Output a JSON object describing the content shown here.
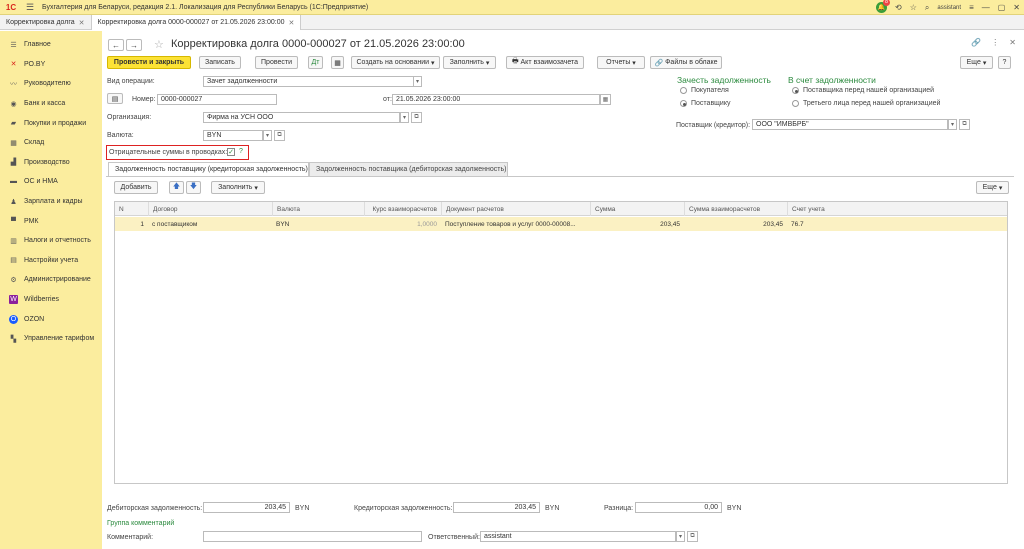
{
  "titlebar": {
    "logo": "1С",
    "title": "Бухгалтерия для Беларуси, редакция 2.1. Локализация для Республики Беларусь   (1С:Предприятие)",
    "notif_count": "8",
    "user": "assistant"
  },
  "tabs": [
    {
      "label": "Корректировка долга"
    },
    {
      "label": "Корректировка долга 0000-000027 от 21.05.2026 23:00:00"
    }
  ],
  "sidebar": {
    "items": [
      {
        "label": "Главное",
        "icon": "menu-icon"
      },
      {
        "label": "РО.BY",
        "icon": "link-icon"
      },
      {
        "label": "Руководителю",
        "icon": "chart-icon"
      },
      {
        "label": "Банк и касса",
        "icon": "bank-icon"
      },
      {
        "label": "Покупки и продажи",
        "icon": "cart-icon"
      },
      {
        "label": "Склад",
        "icon": "warehouse-icon"
      },
      {
        "label": "Производство",
        "icon": "factory-icon"
      },
      {
        "label": "ОС и НМА",
        "icon": "car-icon"
      },
      {
        "label": "Зарплата и кадры",
        "icon": "people-icon"
      },
      {
        "label": "РМК",
        "icon": "register-icon"
      },
      {
        "label": "Налоги и отчетность",
        "icon": "tax-icon"
      },
      {
        "label": "Настройки учета",
        "icon": "settings-icon"
      },
      {
        "label": "Администрирование",
        "icon": "gear-icon"
      },
      {
        "label": "Wildberries",
        "icon": "wildberries-icon"
      },
      {
        "label": "OZON",
        "icon": "ozon-icon"
      },
      {
        "label": "Управление тарифом",
        "icon": "grid-icon"
      }
    ]
  },
  "doc": {
    "title": "Корректировка долга 0000-000027 от 21.05.2026 23:00:00"
  },
  "toolbar": {
    "post_close": "Провести и закрыть",
    "save": "Записать",
    "post": "Провести",
    "create_based": "Создать на основании",
    "fill": "Заполнить",
    "act": "Акт взаимозачета",
    "reports": "Отчеты",
    "files": "Файлы в облаке",
    "more": "Еще"
  },
  "form": {
    "op_label": "Вид операции:",
    "op_value": "Зачет задолженности",
    "number_label": "Номер:",
    "number_value": "0000-000027",
    "date_label": "от:",
    "date_value": "21.05.2026 23:00:00",
    "org_label": "Организация:",
    "org_value": "Фирма на УСН ООО",
    "currency_label": "Валюта:",
    "currency_value": "BYN",
    "negative_label": "Отрицательные суммы в проводках:",
    "negative_help": "?",
    "offset_head": "Зачесть задолженность",
    "offset_buyer": "Покупателя",
    "offset_supplier": "Поставщику",
    "account_head": "В счет задолженности",
    "account_supplier": "Поставщика перед нашей организацией",
    "account_third": "Третьего лица перед нашей организацией",
    "supplier_label": "Поставщик (кредитор):",
    "supplier_value": "ООО \"ИМВБРБ\""
  },
  "subtabs": [
    {
      "label": "Задолженность поставщику (кредиторская задолженность)"
    },
    {
      "label": "Задолженность поставщика (дебиторская задолженность)"
    }
  ],
  "table_toolbar": {
    "add": "Добавить",
    "fill": "Заполнить",
    "more": "Еще"
  },
  "table": {
    "columns": [
      "N",
      "Договор",
      "Валюта",
      "Курс взаиморасчетов",
      "Документ расчетов",
      "Сумма",
      "Сумма взаиморасчетов",
      "Счет учета"
    ],
    "rows": [
      [
        "1",
        "с поставщиком",
        "BYN",
        "1,0000",
        "Поступление товаров и услуг 0000-00008...",
        "203,45",
        "203,45",
        "76.7"
      ]
    ]
  },
  "footer": {
    "debit_label": "Дебиторская задолженность:",
    "debit_value": "203,45",
    "debit_cur": "BYN",
    "credit_label": "Кредиторская задолженность:",
    "credit_value": "203,45",
    "credit_cur": "BYN",
    "diff_label": "Разница:",
    "diff_value": "0,00",
    "diff_cur": "BYN",
    "comments_group": "Группа комментарий",
    "comment_label": "Комментарий:",
    "responsible_label": "Ответственный:",
    "responsible_value": "assistant"
  }
}
